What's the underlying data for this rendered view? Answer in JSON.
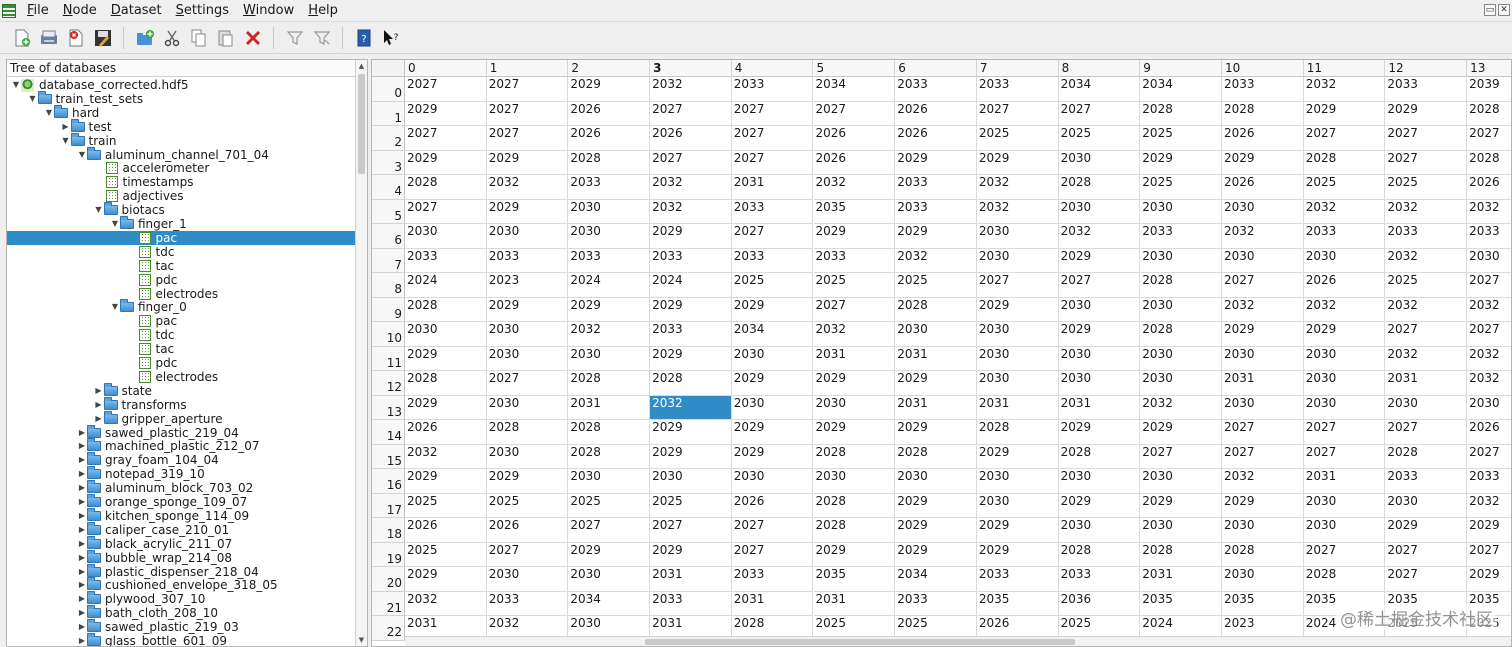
{
  "menu": [
    "File",
    "Node",
    "Dataset",
    "Settings",
    "Window",
    "Help"
  ],
  "menu_mnemonics": [
    "F",
    "N",
    "D",
    "S",
    "W",
    "H"
  ],
  "toolbar": {
    "icons": [
      "new-file-icon",
      "open-file-icon",
      "close-file-icon",
      "save-file-icon",
      "new-group-icon",
      "cut-icon",
      "copy-icon",
      "paste-icon",
      "delete-icon",
      "filter-icon",
      "filter-options-icon",
      "info-icon",
      "whats-this-icon"
    ]
  },
  "tree": {
    "header": "Tree of databases",
    "selected_index": 11,
    "items": [
      {
        "label": "database_corrected.hdf5",
        "level": 0,
        "type": "root",
        "expanded": true
      },
      {
        "label": "train_test_sets",
        "level": 1,
        "type": "group",
        "expanded": true
      },
      {
        "label": "hard",
        "level": 2,
        "type": "group",
        "expanded": true
      },
      {
        "label": "test",
        "level": 3,
        "type": "group",
        "expanded": false
      },
      {
        "label": "train",
        "level": 3,
        "type": "group",
        "expanded": true
      },
      {
        "label": "aluminum_channel_701_04",
        "level": 4,
        "type": "group",
        "expanded": true
      },
      {
        "label": "accelerometer",
        "level": 5,
        "type": "dataset"
      },
      {
        "label": "timestamps",
        "level": 5,
        "type": "dataset"
      },
      {
        "label": "adjectives",
        "level": 5,
        "type": "dataset"
      },
      {
        "label": "biotacs",
        "level": 5,
        "type": "group",
        "expanded": true
      },
      {
        "label": "finger_1",
        "level": 6,
        "type": "group",
        "expanded": true
      },
      {
        "label": "pac",
        "level": 7,
        "type": "dataset"
      },
      {
        "label": "tdc",
        "level": 7,
        "type": "dataset"
      },
      {
        "label": "tac",
        "level": 7,
        "type": "dataset"
      },
      {
        "label": "pdc",
        "level": 7,
        "type": "dataset"
      },
      {
        "label": "electrodes",
        "level": 7,
        "type": "dataset"
      },
      {
        "label": "finger_0",
        "level": 6,
        "type": "group",
        "expanded": true
      },
      {
        "label": "pac",
        "level": 7,
        "type": "dataset"
      },
      {
        "label": "tdc",
        "level": 7,
        "type": "dataset"
      },
      {
        "label": "tac",
        "level": 7,
        "type": "dataset"
      },
      {
        "label": "pdc",
        "level": 7,
        "type": "dataset"
      },
      {
        "label": "electrodes",
        "level": 7,
        "type": "dataset"
      },
      {
        "label": "state",
        "level": 5,
        "type": "group",
        "expanded": false
      },
      {
        "label": "transforms",
        "level": 5,
        "type": "group",
        "expanded": false
      },
      {
        "label": "gripper_aperture",
        "level": 5,
        "type": "group",
        "expanded": false
      },
      {
        "label": "sawed_plastic_219_04",
        "level": 4,
        "type": "group",
        "expanded": false
      },
      {
        "label": "machined_plastic_212_07",
        "level": 4,
        "type": "group",
        "expanded": false
      },
      {
        "label": "gray_foam_104_04",
        "level": 4,
        "type": "group",
        "expanded": false
      },
      {
        "label": "notepad_319_10",
        "level": 4,
        "type": "group",
        "expanded": false
      },
      {
        "label": "aluminum_block_703_02",
        "level": 4,
        "type": "group",
        "expanded": false
      },
      {
        "label": "orange_sponge_109_07",
        "level": 4,
        "type": "group",
        "expanded": false
      },
      {
        "label": "kitchen_sponge_114_09",
        "level": 4,
        "type": "group",
        "expanded": false
      },
      {
        "label": "caliper_case_210_01",
        "level": 4,
        "type": "group",
        "expanded": false
      },
      {
        "label": "black_acrylic_211_07",
        "level": 4,
        "type": "group",
        "expanded": false
      },
      {
        "label": "bubble_wrap_214_08",
        "level": 4,
        "type": "group",
        "expanded": false
      },
      {
        "label": "plastic_dispenser_218_04",
        "level": 4,
        "type": "group",
        "expanded": false
      },
      {
        "label": "cushioned_envelope_318_05",
        "level": 4,
        "type": "group",
        "expanded": false
      },
      {
        "label": "plywood_307_10",
        "level": 4,
        "type": "group",
        "expanded": false
      },
      {
        "label": "bath_cloth_208_10",
        "level": 4,
        "type": "group",
        "expanded": false
      },
      {
        "label": "sawed_plastic_219_03",
        "level": 4,
        "type": "group",
        "expanded": false
      },
      {
        "label": "glass_bottle_601_09",
        "level": 4,
        "type": "group",
        "expanded": false
      }
    ]
  },
  "table": {
    "columns": [
      "0",
      "1",
      "2",
      "3",
      "4",
      "5",
      "6",
      "7",
      "8",
      "9",
      "10",
      "11",
      "12",
      "13"
    ],
    "bold_column": 3,
    "selected_cell": [
      13,
      3
    ],
    "rows": [
      {
        "label": "0",
        "values": [
          "2027",
          "2027",
          "2029",
          "2032",
          "2033",
          "2034",
          "2033",
          "2033",
          "2034",
          "2034",
          "2033",
          "2032",
          "2033",
          "2039"
        ]
      },
      {
        "label": "1",
        "values": [
          "2029",
          "2027",
          "2026",
          "2027",
          "2027",
          "2027",
          "2026",
          "2027",
          "2027",
          "2028",
          "2028",
          "2029",
          "2029",
          "2028"
        ]
      },
      {
        "label": "2",
        "values": [
          "2027",
          "2027",
          "2026",
          "2026",
          "2027",
          "2026",
          "2026",
          "2025",
          "2025",
          "2025",
          "2026",
          "2027",
          "2027",
          "2027"
        ]
      },
      {
        "label": "3",
        "values": [
          "2029",
          "2029",
          "2028",
          "2027",
          "2027",
          "2026",
          "2029",
          "2029",
          "2030",
          "2029",
          "2029",
          "2028",
          "2027",
          "2028"
        ]
      },
      {
        "label": "4",
        "values": [
          "2028",
          "2032",
          "2033",
          "2032",
          "2031",
          "2032",
          "2033",
          "2032",
          "2028",
          "2025",
          "2026",
          "2025",
          "2025",
          "2026"
        ]
      },
      {
        "label": "5",
        "values": [
          "2027",
          "2029",
          "2030",
          "2032",
          "2033",
          "2035",
          "2033",
          "2032",
          "2030",
          "2030",
          "2030",
          "2032",
          "2032",
          "2032"
        ]
      },
      {
        "label": "6",
        "values": [
          "2030",
          "2030",
          "2030",
          "2029",
          "2027",
          "2029",
          "2029",
          "2030",
          "2032",
          "2033",
          "2032",
          "2033",
          "2033",
          "2033"
        ]
      },
      {
        "label": "7",
        "values": [
          "2033",
          "2033",
          "2033",
          "2033",
          "2033",
          "2033",
          "2032",
          "2030",
          "2029",
          "2030",
          "2030",
          "2030",
          "2032",
          "2030"
        ]
      },
      {
        "label": "8",
        "values": [
          "2024",
          "2023",
          "2024",
          "2024",
          "2025",
          "2025",
          "2025",
          "2027",
          "2027",
          "2028",
          "2027",
          "2026",
          "2025",
          "2027"
        ]
      },
      {
        "label": "9",
        "values": [
          "2028",
          "2029",
          "2029",
          "2029",
          "2029",
          "2027",
          "2028",
          "2029",
          "2030",
          "2030",
          "2032",
          "2032",
          "2032",
          "2032"
        ]
      },
      {
        "label": "10",
        "values": [
          "2030",
          "2030",
          "2032",
          "2033",
          "2034",
          "2032",
          "2030",
          "2030",
          "2029",
          "2028",
          "2029",
          "2029",
          "2027",
          "2027"
        ]
      },
      {
        "label": "11",
        "values": [
          "2029",
          "2030",
          "2030",
          "2029",
          "2030",
          "2031",
          "2031",
          "2030",
          "2030",
          "2030",
          "2030",
          "2030",
          "2032",
          "2032"
        ]
      },
      {
        "label": "12",
        "values": [
          "2028",
          "2027",
          "2028",
          "2028",
          "2029",
          "2029",
          "2029",
          "2030",
          "2030",
          "2030",
          "2031",
          "2030",
          "2031",
          "2032"
        ]
      },
      {
        "label": "13",
        "values": [
          "2029",
          "2030",
          "2031",
          "2032",
          "2030",
          "2030",
          "2031",
          "2031",
          "2031",
          "2032",
          "2030",
          "2030",
          "2030",
          "2030"
        ]
      },
      {
        "label": "14",
        "values": [
          "2026",
          "2028",
          "2028",
          "2029",
          "2029",
          "2029",
          "2029",
          "2028",
          "2029",
          "2029",
          "2027",
          "2027",
          "2027",
          "2026"
        ]
      },
      {
        "label": "15",
        "values": [
          "2032",
          "2030",
          "2028",
          "2029",
          "2029",
          "2028",
          "2028",
          "2029",
          "2028",
          "2027",
          "2027",
          "2027",
          "2028",
          "2027"
        ]
      },
      {
        "label": "16",
        "values": [
          "2029",
          "2029",
          "2030",
          "2030",
          "2030",
          "2030",
          "2030",
          "2030",
          "2030",
          "2030",
          "2032",
          "2031",
          "2033",
          "2033"
        ]
      },
      {
        "label": "17",
        "values": [
          "2025",
          "2025",
          "2025",
          "2025",
          "2026",
          "2028",
          "2029",
          "2030",
          "2029",
          "2029",
          "2029",
          "2030",
          "2030",
          "2032"
        ]
      },
      {
        "label": "18",
        "values": [
          "2026",
          "2026",
          "2027",
          "2027",
          "2027",
          "2028",
          "2029",
          "2029",
          "2030",
          "2030",
          "2030",
          "2030",
          "2029",
          "2029"
        ]
      },
      {
        "label": "19",
        "values": [
          "2025",
          "2027",
          "2029",
          "2029",
          "2027",
          "2029",
          "2029",
          "2029",
          "2028",
          "2028",
          "2028",
          "2027",
          "2027",
          "2027"
        ]
      },
      {
        "label": "20",
        "values": [
          "2029",
          "2030",
          "2030",
          "2031",
          "2033",
          "2035",
          "2034",
          "2033",
          "2033",
          "2031",
          "2030",
          "2028",
          "2027",
          "2029"
        ]
      },
      {
        "label": "21",
        "values": [
          "2032",
          "2033",
          "2034",
          "2033",
          "2031",
          "2031",
          "2033",
          "2035",
          "2036",
          "2035",
          "2035",
          "2035",
          "2035",
          "2035"
        ]
      },
      {
        "label": "22",
        "values": [
          "2031",
          "2032",
          "2030",
          "2031",
          "2028",
          "2025",
          "2025",
          "2026",
          "2025",
          "2024",
          "2023",
          "2024",
          "2025",
          "2025"
        ]
      }
    ]
  },
  "watermark": "@稀土掘金技术社区"
}
